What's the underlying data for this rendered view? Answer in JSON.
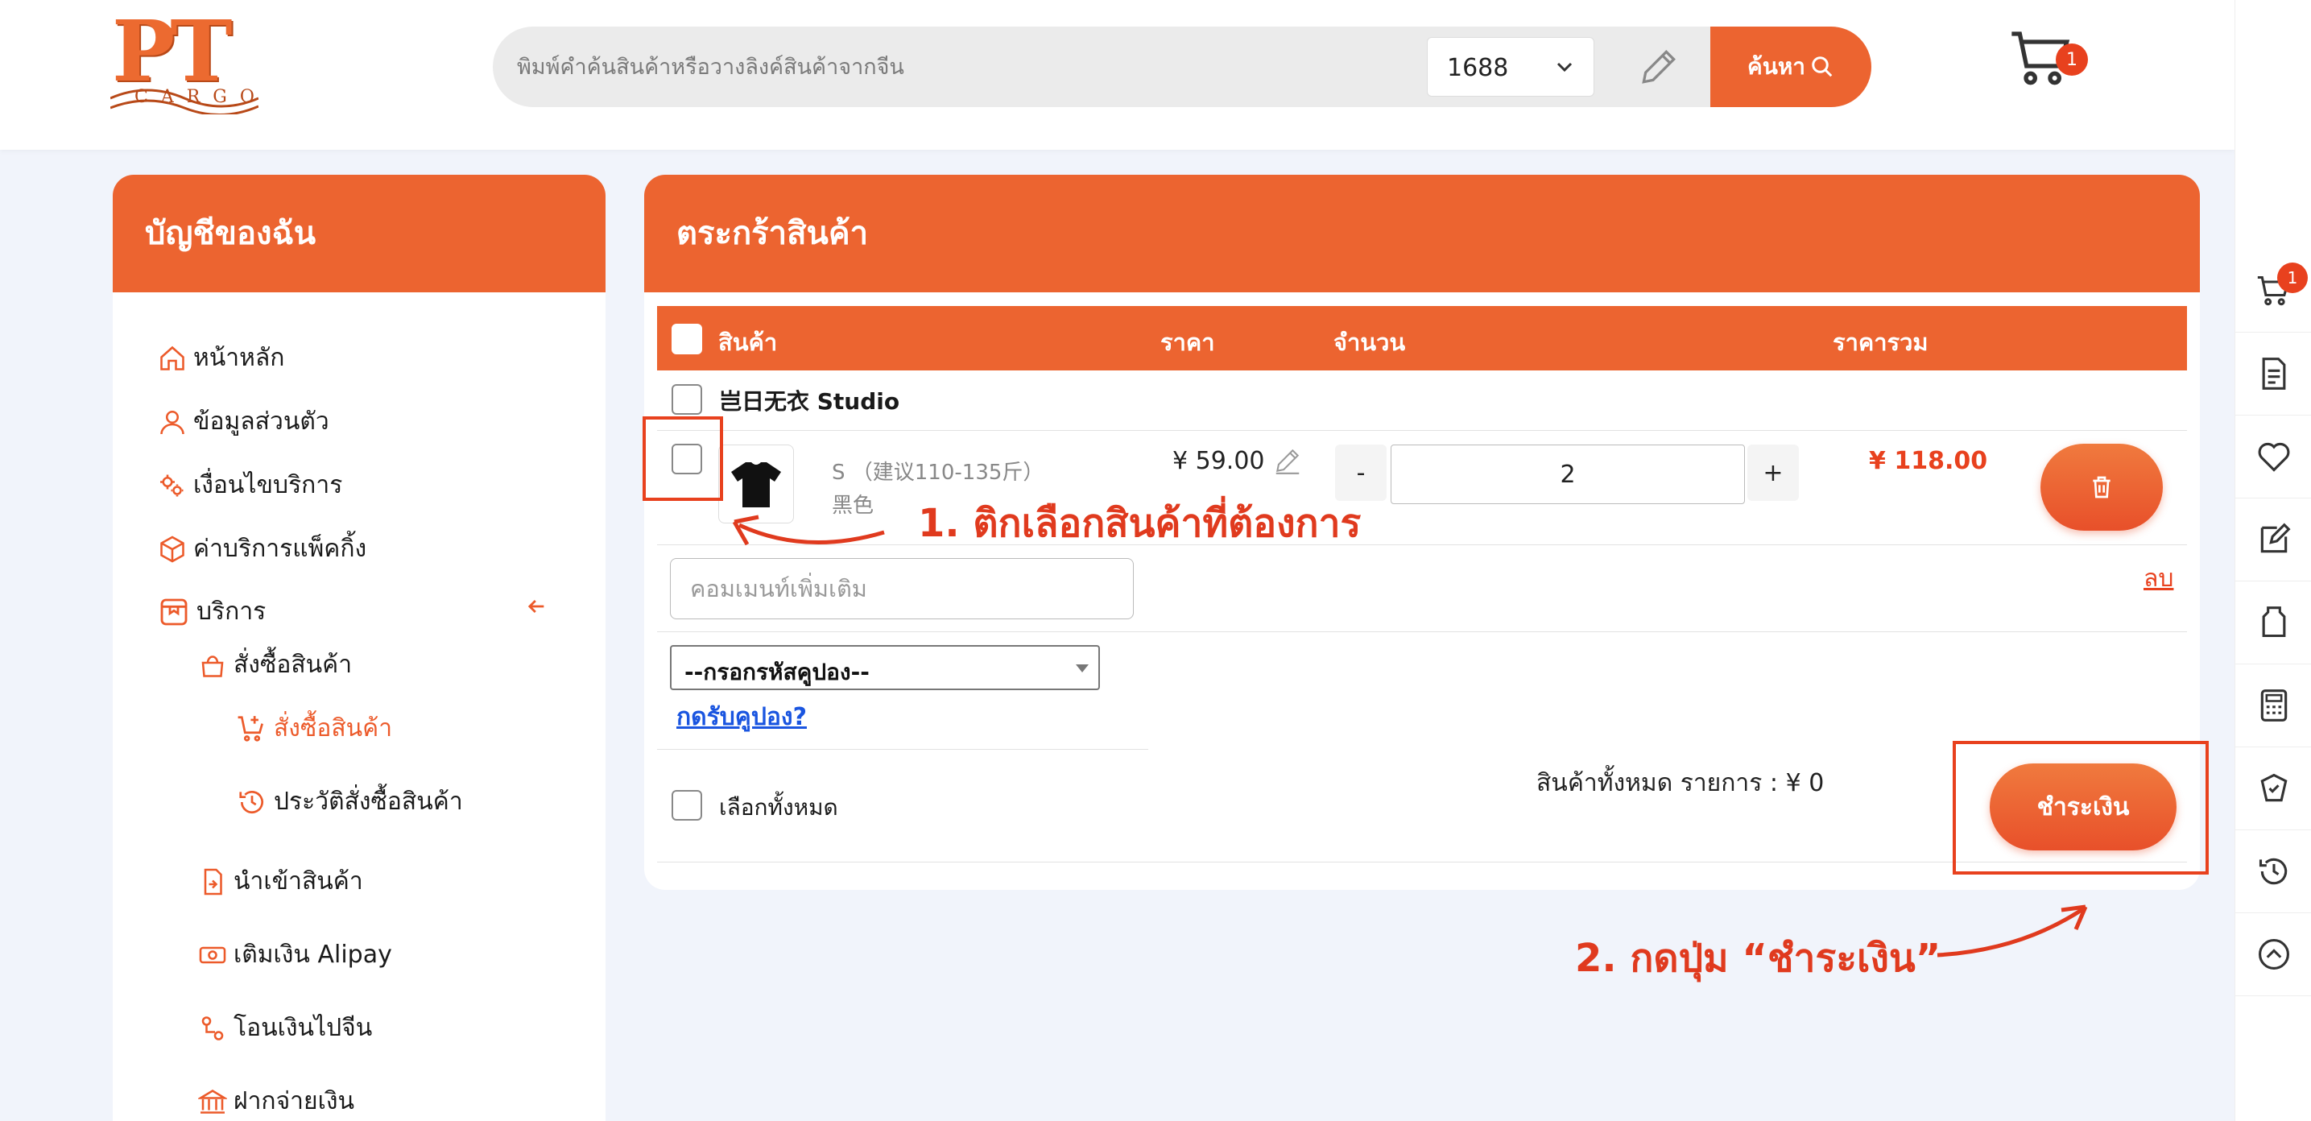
{
  "colors": {
    "accent": "#ec6430",
    "price": "#e8411e",
    "link": "#1a55e0",
    "annotation": "#e03a1e"
  },
  "header": {
    "logo_main": "PT",
    "logo_sub": "CARGO",
    "search_placeholder": "พิมพ์คำค้นสินค้าหรือวางลิงค์สินค้าจากจีน",
    "source_value": "1688",
    "search_label": "ค้นหา",
    "cart_count": "1"
  },
  "right_rail": {
    "cart_count": "1",
    "icons": [
      "cart-icon",
      "document-icon",
      "heart-icon",
      "edit-note-icon",
      "box-icon",
      "calculator-icon",
      "badge-icon",
      "history-icon",
      "scroll-top-icon"
    ]
  },
  "sidebar": {
    "title": "บัญชีของฉัน",
    "items": [
      {
        "label": "หน้าหลัก",
        "icon": "home-icon"
      },
      {
        "label": "ข้อมูลส่วนตัว",
        "icon": "user-icon"
      },
      {
        "label": "เงื่อนไขบริการ",
        "icon": "gears-icon"
      },
      {
        "label": "ค่าบริการแพ็คกิ้ง",
        "icon": "package-icon"
      },
      {
        "label": "บริการ",
        "icon": "service-icon"
      },
      {
        "label": "สั่งซื้อสินค้า",
        "icon": "bag-icon"
      },
      {
        "label": "สั่งซื้อสินค้า",
        "icon": "cart-plus-icon",
        "active": true
      },
      {
        "label": "ประวัติสั่งซื้อสินค้า",
        "icon": "history-icon"
      },
      {
        "label": "นำเข้าสินค้า",
        "icon": "import-icon"
      },
      {
        "label": "เติมเงิน Alipay",
        "icon": "money-icon"
      },
      {
        "label": "โอนเงินไปจีน",
        "icon": "transfer-icon"
      },
      {
        "label": "ฝากจ่ายเงิน",
        "icon": "bank-icon"
      }
    ]
  },
  "cart": {
    "title": "ตระกร้าสินค้า",
    "columns": {
      "product": "สินค้า",
      "price": "ราคา",
      "quantity": "จำนวน",
      "total": "ราคารวม"
    },
    "shop_name": "岂日无衣 Studio",
    "item": {
      "variant_size": "S （建议110-135斤）",
      "variant_color": "黑色",
      "unit_price": "¥ 59.00",
      "quantity": "2",
      "line_total": "¥ 118.00",
      "minus": "-",
      "plus": "+"
    },
    "remove_label": "ลบ",
    "comment_placeholder": "คอมเมนท์เพิ่มเติม",
    "coupon_placeholder": "--กรอกรหัสคูปอง--",
    "coupon_link": "กดรับคูปอง?",
    "select_all": "เลือกทั้งหมด",
    "summary": "สินค้าทั้งหมด  รายการ : ¥ 0",
    "checkout_label": "ชำระเงิน"
  },
  "annotations": {
    "step1": "1. ติกเลือกสินค้าที่ต้องการ",
    "step2": "2. กดปุ่ม “ชำระเงิน”"
  }
}
